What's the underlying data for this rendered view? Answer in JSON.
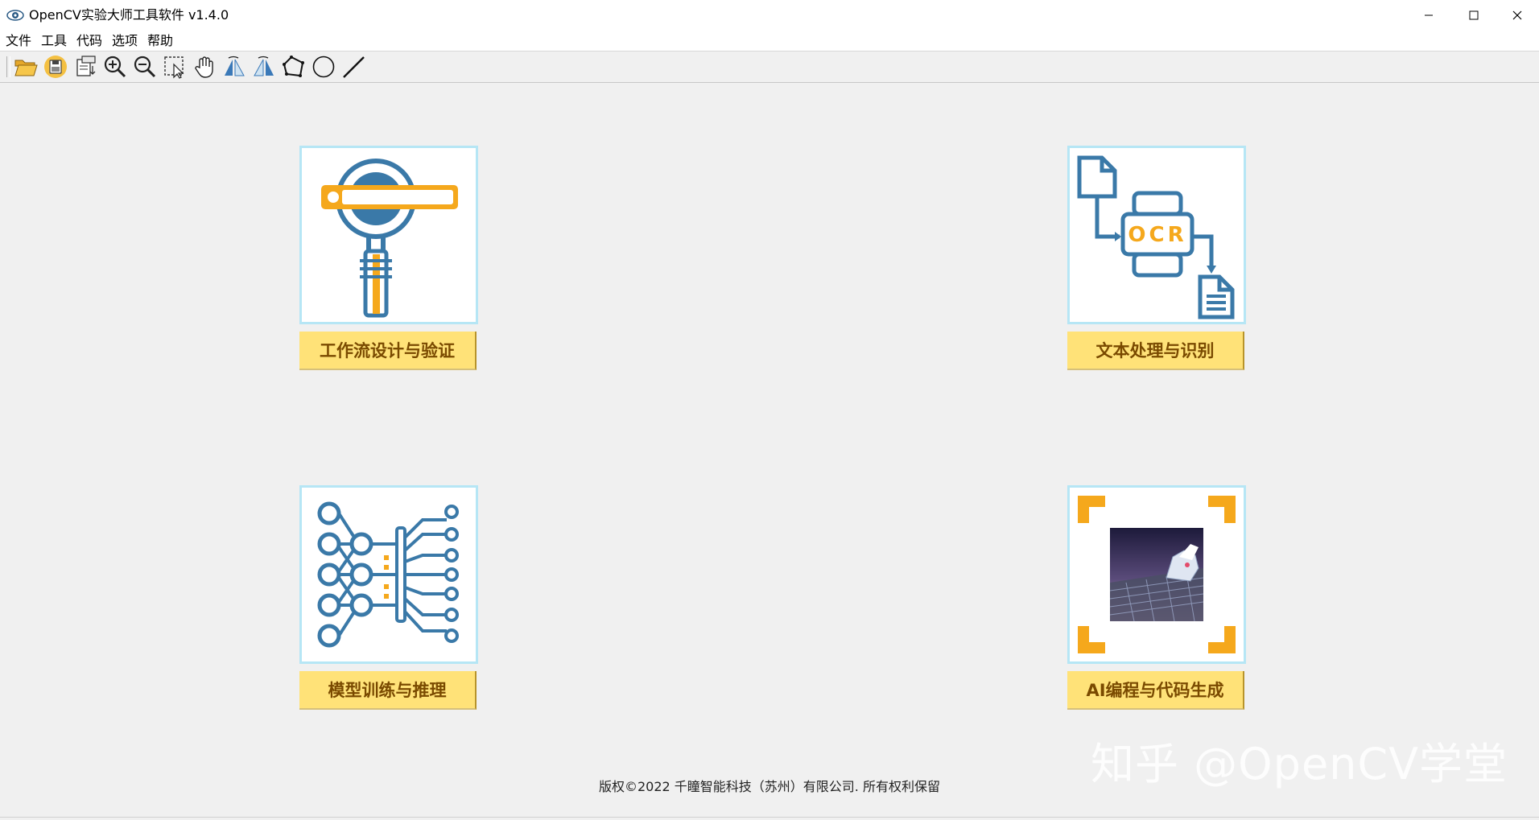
{
  "window": {
    "title": "OpenCV实验大师工具软件 v1.4.0",
    "minimize_icon": "minimize-icon",
    "maximize_icon": "maximize-icon",
    "close_icon": "close-icon"
  },
  "menu": {
    "items": [
      {
        "label": "文件"
      },
      {
        "label": "工具"
      },
      {
        "label": "代码"
      },
      {
        "label": "选项"
      },
      {
        "label": "帮助"
      }
    ]
  },
  "toolbar": {
    "buttons": [
      {
        "icon": "open-folder-icon"
      },
      {
        "icon": "save-icon"
      },
      {
        "icon": "export-pdf-icon"
      },
      {
        "icon": "zoom-in-icon"
      },
      {
        "icon": "zoom-out-icon"
      },
      {
        "icon": "select-region-icon"
      },
      {
        "icon": "pan-hand-icon"
      },
      {
        "icon": "flip-left-icon"
      },
      {
        "icon": "flip-right-icon"
      },
      {
        "icon": "polygon-icon"
      },
      {
        "icon": "circle-icon"
      },
      {
        "icon": "line-icon"
      }
    ]
  },
  "tiles": [
    {
      "label": "工作流设计与验证",
      "icon": "magnifier-workflow-icon"
    },
    {
      "label": "文本处理与识别",
      "icon": "ocr-document-icon",
      "icon_text": "OCR"
    },
    {
      "label": "模型训练与推理",
      "icon": "neural-network-icon"
    },
    {
      "label": "AI编程与代码生成",
      "icon": "ai-robot-image"
    }
  ],
  "footer": {
    "copyright": "版权©2022 千瞳智能科技（苏州）有限公司. 所有权利保留"
  },
  "watermark": "知乎 @OpenCV学堂",
  "colors": {
    "accent_blue": "#3a79a8",
    "accent_yellow": "#f5a81c",
    "tile_border": "#b6e6f5",
    "label_bg": "#ffe278",
    "label_text": "#7a4a00"
  }
}
